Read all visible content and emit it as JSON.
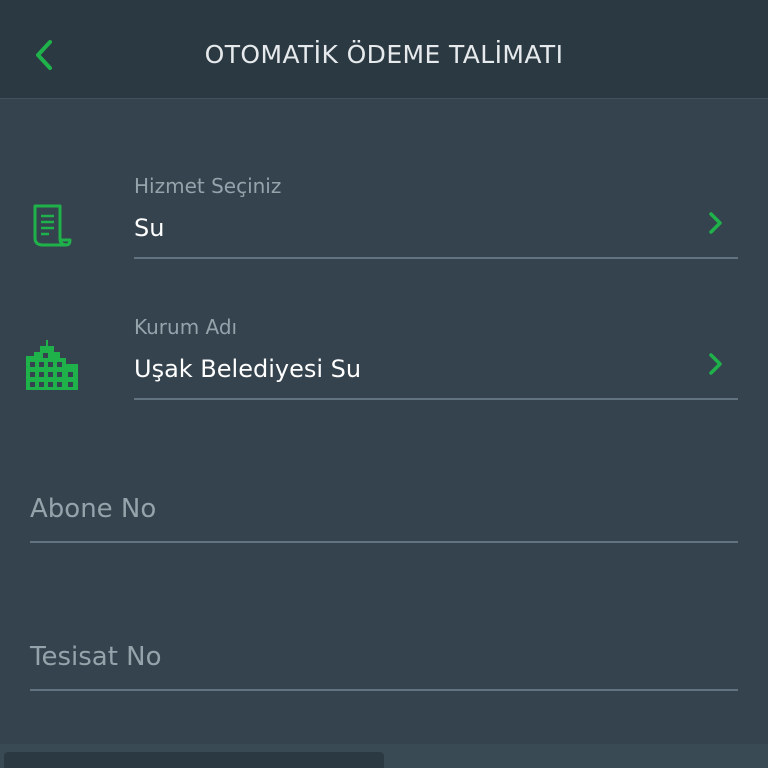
{
  "header": {
    "title": "OTOMATİK ÖDEME TALİMATI"
  },
  "icons": {
    "back": "chevron-left-icon",
    "service": "receipt-icon",
    "institution": "buildings-icon",
    "chevron": "chevron-right-icon"
  },
  "colors": {
    "accent": "#1fb24a",
    "header_bg": "#2b3942",
    "body_bg": "#34434e"
  },
  "form": {
    "service": {
      "label": "Hizmet Seçiniz",
      "value": "Su"
    },
    "institution": {
      "label": "Kurum Adı",
      "value": "Uşak Belediyesi Su"
    },
    "subscriber_no": {
      "placeholder": "Abone No",
      "value": ""
    },
    "installation_no": {
      "placeholder": "Tesisat No",
      "value": ""
    }
  }
}
